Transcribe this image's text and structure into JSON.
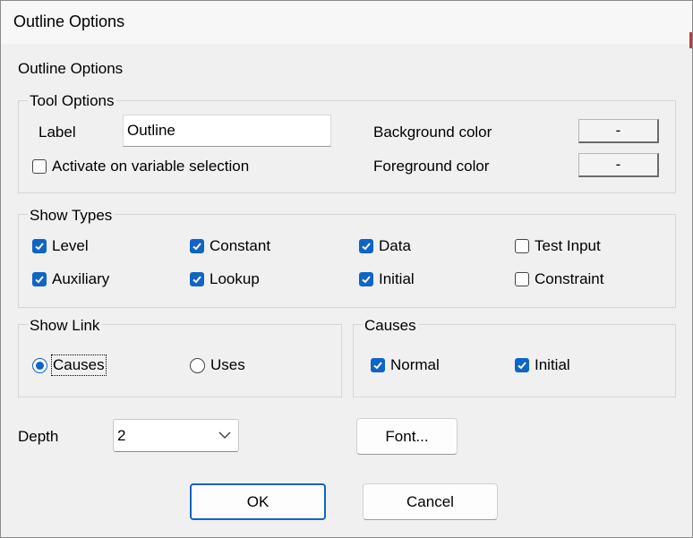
{
  "window": {
    "title": "Outline Options"
  },
  "dialog": {
    "heading": "Outline Options",
    "tool_options": {
      "legend": "Tool Options",
      "label_caption": "Label",
      "label_value": "Outline",
      "activate_label": "Activate on variable selection",
      "activate_checked": false,
      "background_caption": "Background color",
      "background_button": "-",
      "foreground_caption": "Foreground color",
      "foreground_button": "-"
    },
    "show_types": {
      "legend": "Show Types",
      "items": [
        {
          "label": "Level",
          "checked": true
        },
        {
          "label": "Constant",
          "checked": true
        },
        {
          "label": "Data",
          "checked": true
        },
        {
          "label": "Test Input",
          "checked": false
        },
        {
          "label": "Auxiliary",
          "checked": true
        },
        {
          "label": "Lookup",
          "checked": true
        },
        {
          "label": "Initial",
          "checked": true
        },
        {
          "label": "Constraint",
          "checked": false
        }
      ]
    },
    "show_link": {
      "legend": "Show Link",
      "options": [
        {
          "label": "Causes",
          "selected": true
        },
        {
          "label": "Uses",
          "selected": false
        }
      ]
    },
    "causes": {
      "legend": "Causes",
      "items": [
        {
          "label": "Normal",
          "checked": true
        },
        {
          "label": "Initial",
          "checked": true
        }
      ]
    },
    "depth": {
      "caption": "Depth",
      "value": "2"
    },
    "font_button": "Font...",
    "ok_button": "OK",
    "cancel_button": "Cancel"
  },
  "colors": {
    "accent": "#0f65c4"
  }
}
